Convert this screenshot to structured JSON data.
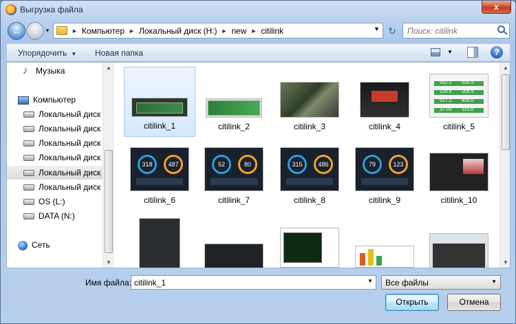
{
  "window": {
    "title": "Выгрузка файла",
    "close": "x"
  },
  "nav": {
    "breadcrumb": [
      "Компьютер",
      "Локальный диск (H:)",
      "new",
      "citilink"
    ],
    "search_placeholder": "Поиск: citilink"
  },
  "toolbar": {
    "organize": "Упорядочить",
    "new_folder": "Новая папка",
    "help": "?"
  },
  "sidebar": {
    "items": [
      {
        "label": "Музыка",
        "icon": "music-icon"
      },
      {
        "label": "Компьютер",
        "icon": "computer-icon"
      },
      {
        "label": "Локальный диск",
        "icon": "drive-icon"
      },
      {
        "label": "Локальный диск",
        "icon": "drive-icon"
      },
      {
        "label": "Локальный диск",
        "icon": "drive-icon"
      },
      {
        "label": "Локальный диск",
        "icon": "drive-icon"
      },
      {
        "label": "Локальный диск",
        "icon": "drive-icon"
      },
      {
        "label": "Локальный диск",
        "icon": "drive-icon"
      },
      {
        "label": "OS (L:)",
        "icon": "drive-icon"
      },
      {
        "label": "DATA (N:)",
        "icon": "drive-icon"
      },
      {
        "label": "Сеть",
        "icon": "network-icon"
      }
    ]
  },
  "files": [
    {
      "name": "citilink_1",
      "selected": true
    },
    {
      "name": "citilink_2"
    },
    {
      "name": "citilink_3"
    },
    {
      "name": "citilink_4"
    },
    {
      "name": "citilink_5"
    },
    {
      "name": "citilink_6",
      "gauges": [
        "318",
        "487"
      ]
    },
    {
      "name": "citilink_7",
      "gauges": [
        "52",
        "80"
      ]
    },
    {
      "name": "citilink_8",
      "gauges": [
        "315",
        "486"
      ]
    },
    {
      "name": "citilink_9",
      "gauges": [
        "79",
        "123"
      ]
    },
    {
      "name": "citilink_10"
    }
  ],
  "bench_values": [
    [
      "552.2",
      "526.5"
    ],
    [
      "226.6",
      "209.9"
    ],
    [
      "517.2",
      "496.0"
    ],
    [
      "37.03",
      "115.8"
    ]
  ],
  "bottom": {
    "filename_label": "Имя файла:",
    "filename_value": "citilink_1",
    "filetype": "Все файлы",
    "open": "Открыть",
    "cancel": "Отмена"
  }
}
